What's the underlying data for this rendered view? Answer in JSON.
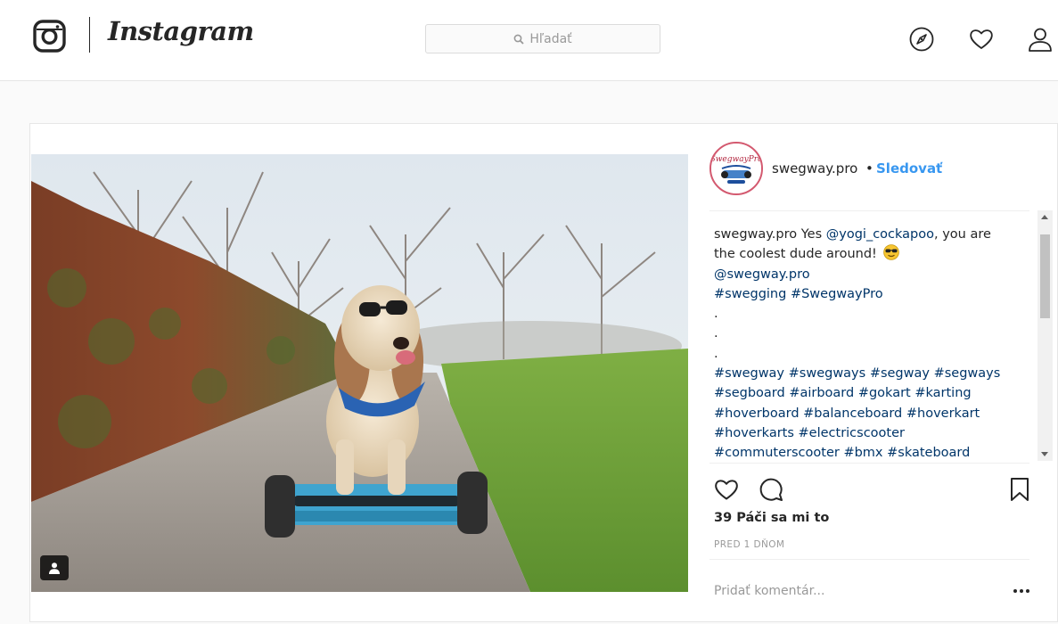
{
  "app": {
    "wordmark": "Instagram"
  },
  "search": {
    "placeholder": "Hľadať"
  },
  "nav_icons": [
    "compass-icon",
    "heart-icon",
    "profile-icon"
  ],
  "post": {
    "author": "swegway.pro",
    "separator": "•",
    "follow_label": "Sledovať",
    "avatar_text": "SwegwayPro",
    "caption": {
      "username": "swegway.pro",
      "line1_text": "Yes ",
      "mention1": "@yogi_cockapoo",
      "line1_tail": ", you are",
      "line2": "the coolest dude around!",
      "emoji": "sunglasses-emoji",
      "mention2": "@swegway.pro",
      "tags_line1": [
        "#swegging",
        "#SwegwayPro"
      ],
      "dots": [
        ".",
        ".",
        "."
      ],
      "tags_lines": [
        [
          "#swegway",
          "#swegways",
          "#segway",
          "#segways"
        ],
        [
          "#segboard",
          "#airboard",
          "#gokart",
          "#karting"
        ],
        [
          "#hoverboard",
          "#balanceboard",
          "#hoverkart"
        ],
        [
          "#hoverkarts",
          "#electricscooter"
        ],
        [
          "#commuterscooter",
          "#bmx",
          "#skateboard"
        ]
      ]
    },
    "likes": "39 Páči sa mi to",
    "timestamp": "PRED 1 DŇOM",
    "comment_placeholder": "Pridať komentár..."
  },
  "colors": {
    "link_blue": "#3897f0",
    "hashtag_blue": "#003569",
    "text": "#262626",
    "muted": "#999999",
    "border": "#e6e6e6"
  }
}
